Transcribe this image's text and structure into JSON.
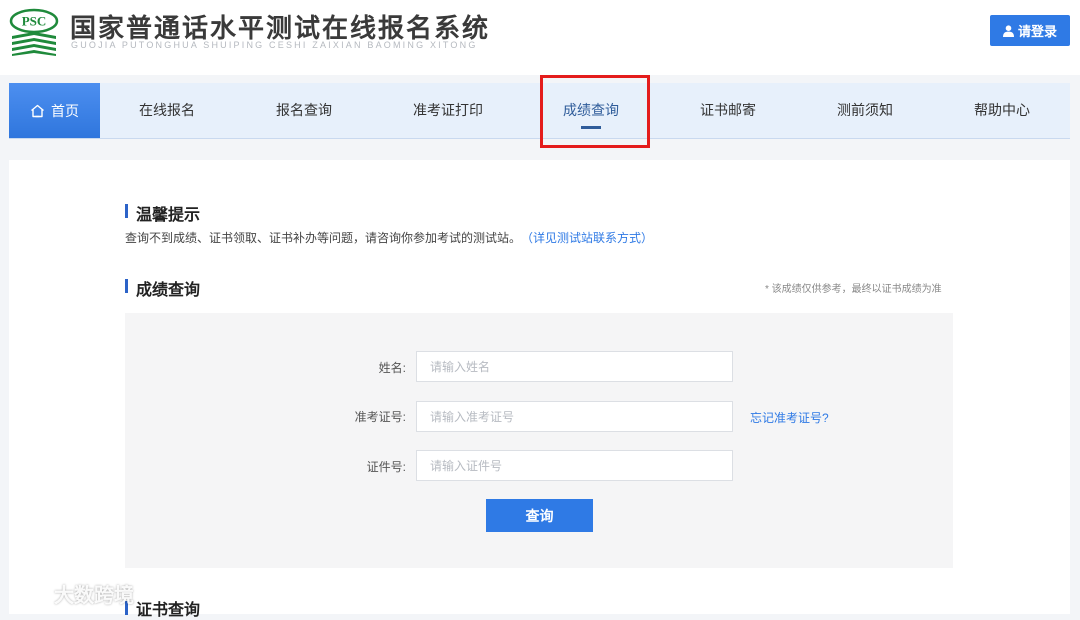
{
  "header": {
    "logo_text": "PSC",
    "title": "国家普通话水平测试在线报名系统",
    "subtitle": "GUOJIA PUTONGHUA SHUIPING CESHI ZAIXIAN BAOMING XITONG",
    "login_label": "请登录"
  },
  "nav": {
    "items": [
      {
        "label": "首页"
      },
      {
        "label": "在线报名"
      },
      {
        "label": "报名查询"
      },
      {
        "label": "准考证打印"
      },
      {
        "label": "成绩查询"
      },
      {
        "label": "证书邮寄"
      },
      {
        "label": "测前须知"
      },
      {
        "label": "帮助中心"
      }
    ],
    "active": "成绩查询"
  },
  "tips": {
    "title": "温馨提示",
    "text": "查询不到成绩、证书领取、证书补办等问题，请咨询你参加考试的测试站。",
    "link": "（详见测试站联系方式）"
  },
  "score_query": {
    "title": "成绩查询",
    "disclaimer": "* 该成绩仅供参考，最终以证书成绩为准",
    "fields": [
      {
        "label": "姓名:",
        "placeholder": "请输入姓名",
        "value": ""
      },
      {
        "label": "准考证号:",
        "placeholder": "请输入准考证号",
        "value": ""
      },
      {
        "label": "证件号:",
        "placeholder": "请输入证件号",
        "value": ""
      }
    ],
    "forgot_link": "忘记准考证号?",
    "submit_label": "查询"
  },
  "certificate_query": {
    "title": "证书查询"
  },
  "watermark": {
    "text": "大数跨境"
  },
  "colors": {
    "primary": "#2f7ae5",
    "nav_bg": "#e7f0fb",
    "highlight": "#e41c1c",
    "section_bar": "#2c63c8"
  }
}
